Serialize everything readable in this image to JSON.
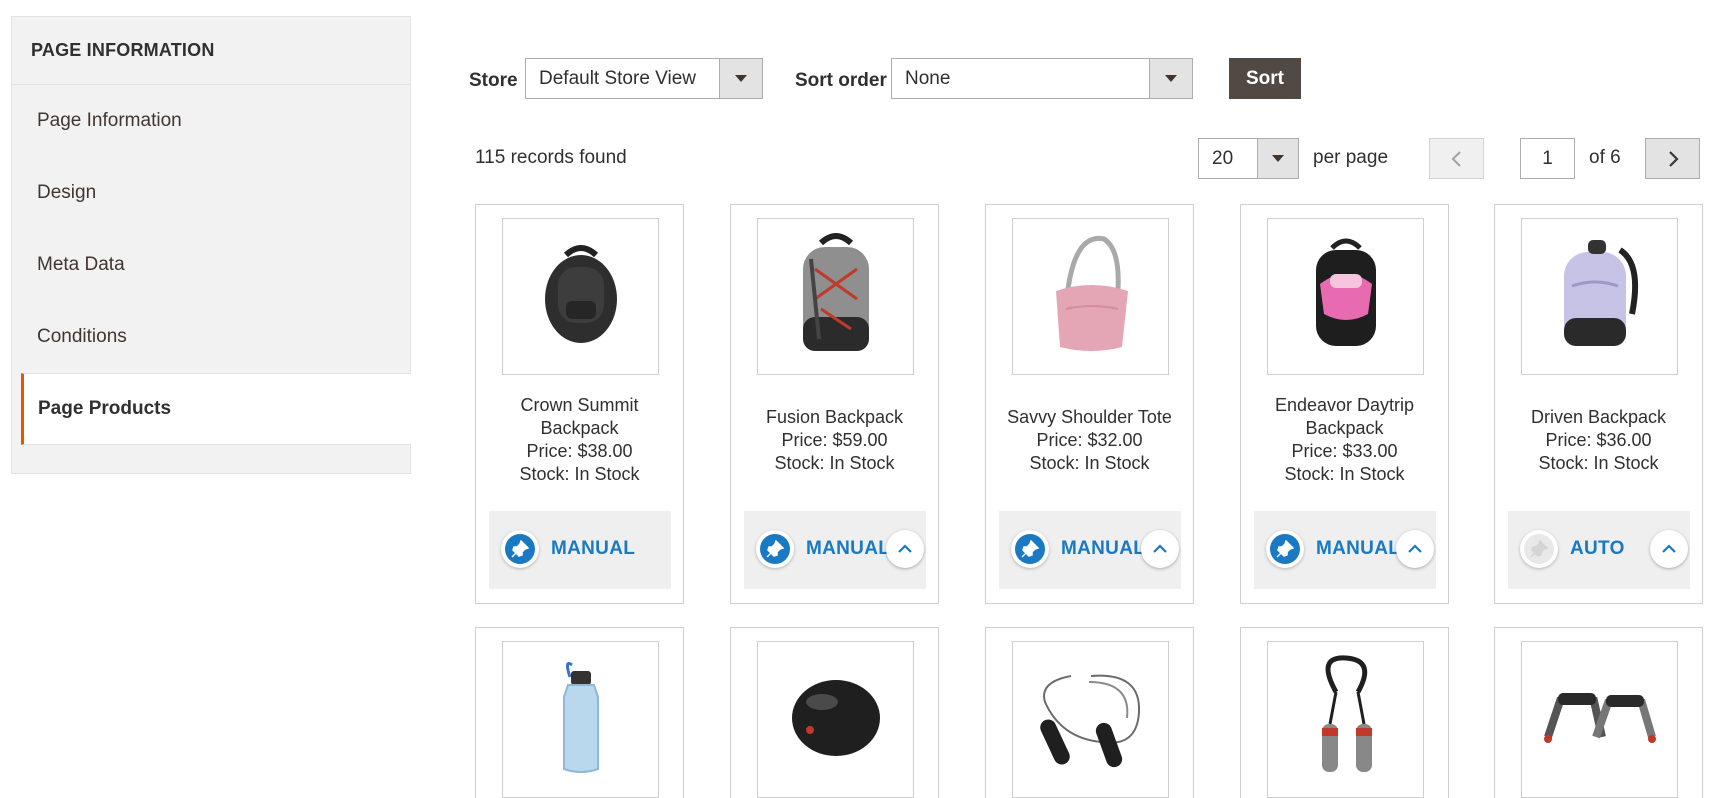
{
  "sidebar": {
    "title": "PAGE INFORMATION",
    "items": [
      {
        "label": "Page Information"
      },
      {
        "label": "Design"
      },
      {
        "label": "Meta Data"
      },
      {
        "label": "Conditions"
      },
      {
        "label": "Page Products"
      }
    ],
    "active_item": "Page Products"
  },
  "toolbar": {
    "store_label": "Store",
    "store_value": "Default Store View",
    "sort_order_label": "Sort order",
    "sort_order_value": "None",
    "sort_button": "Sort"
  },
  "pager": {
    "records": "115 records found",
    "per_page_value": "20",
    "per_page_label": "per page",
    "current_page": "1",
    "of_pages": "of 6"
  },
  "colors": {
    "accent": "#eb5202",
    "link_blue": "#1979c3",
    "button_dark": "#514943"
  },
  "products": [
    {
      "name": "Crown Summit Backpack",
      "price": "Price: $38.00",
      "stock": "Stock: In Stock",
      "mode": "MANUAL",
      "icon": "backpack-black-icon"
    },
    {
      "name": "Fusion Backpack",
      "price": "Price: $59.00",
      "stock": "Stock: In Stock",
      "mode": "MANUAL",
      "icon": "backpack-gray-red-icon"
    },
    {
      "name": "Savvy Shoulder Tote",
      "price": "Price: $32.00",
      "stock": "Stock: In Stock",
      "mode": "MANUAL",
      "icon": "tote-pink-icon"
    },
    {
      "name": "Endeavor Daytrip Backpack",
      "price": "Price: $33.00",
      "stock": "Stock: In Stock",
      "mode": "MANUAL",
      "icon": "backpack-pink-icon"
    },
    {
      "name": "Driven Backpack",
      "price": "Price: $36.00",
      "stock": "Stock: In Stock",
      "mode": "AUTO",
      "icon": "backpack-lavender-icon"
    }
  ],
  "products_row2_icons": [
    "water-bottle-icon",
    "sport-ball-icon",
    "jump-rope-icon",
    "resistance-band-icon",
    "pushup-handles-icon"
  ]
}
